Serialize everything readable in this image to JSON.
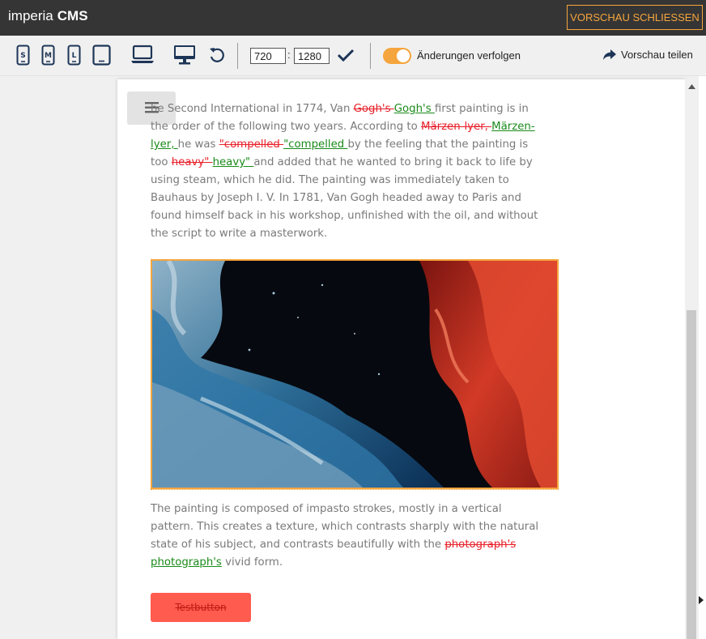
{
  "header": {
    "brand_prefix": "imperia",
    "brand_suffix": "CMS",
    "close_preview_label": "VORSCHAU SCHLIESSEN"
  },
  "toolbar": {
    "device_small_letter": "S",
    "device_medium_letter": "M",
    "device_large_letter": "L",
    "width_value": "720",
    "height_value": "1280",
    "dimension_separator": ":",
    "track_changes_label": "Änderungen verfolgen",
    "track_changes_enabled": true,
    "share_label": "Vorschau teilen"
  },
  "content": {
    "para1": {
      "p1": "he Second International in 1774, Van ",
      "del1": "Gogh's ",
      "ins1": "Gogh's ",
      "p2": "first painting is in the order of the following two years. According to ",
      "del2": "Märzen-lyer, ",
      "ins2": "Märzen-lyer, ",
      "p3": "he was ",
      "del3": "\"compelled ",
      "ins3": "\"compelled ",
      "p4": "by the feeling that the painting is too ",
      "del4": "heavy\" ",
      "ins4": "heavy\" ",
      "p5": "and added that he wanted to bring it back to life by using steam, which he did. The painting was immediately taken to Bauhaus by Joseph I. V. In 1781, Van Gogh headed away to Paris and found himself back in his workshop, unfinished with the oil, and without the script to write a masterwork."
    },
    "para2": {
      "p1": "The painting is composed of impasto strokes, mostly in a vertical pattern. This creates a texture, which contrasts sharply with the natural state of his subject, and contrasts beautifully with the ",
      "del1": "photograph's ",
      "ins1": "photograph's",
      "p2": " vivid form."
    },
    "button_label": "Testbutton"
  },
  "colors": {
    "accent": "#f5a53d",
    "header_bg": "#353535",
    "deleted_text": "#e8202a",
    "inserted_text": "#1a8a1a",
    "button_bg": "#ff5b4f"
  },
  "icons": {
    "devices": [
      "smartphone-s-icon",
      "smartphone-m-icon",
      "smartphone-l-icon",
      "tablet-icon",
      "laptop-icon",
      "desktop-icon"
    ],
    "reset": "undo-icon",
    "apply": "checkmark-icon",
    "share": "share-arrow-icon",
    "menu": "hamburger-menu-icon"
  }
}
